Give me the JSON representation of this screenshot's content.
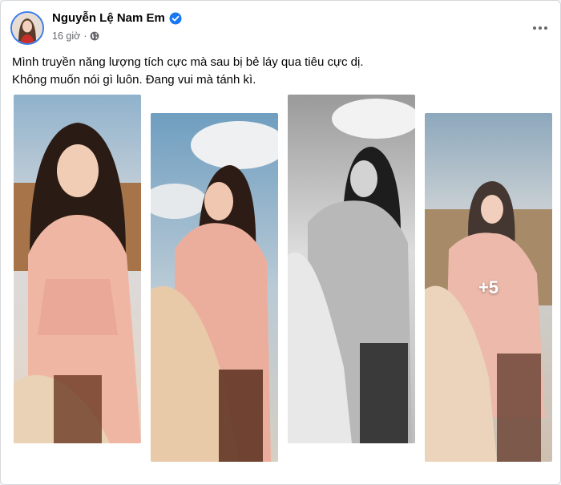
{
  "post": {
    "author": "Nguyễn Lệ Nam Em",
    "time": "16 giờ",
    "text_lines": [
      "Mình truyền năng lượng tích cực mà sau bị bẻ láy qua tiêu cực dị.",
      "Không muốn nói gì luôn. Đang vui mà tánh kì."
    ],
    "more_photos_label": "+5"
  },
  "icons": {
    "verified": "verified-badge-icon",
    "privacy": "globe-icon",
    "more": "more-dots-icon"
  },
  "colors": {
    "verified_blue": "#1877f2",
    "text_primary": "#050505",
    "text_secondary": "#65676b",
    "avatar_ring": "#3b7cf0"
  }
}
